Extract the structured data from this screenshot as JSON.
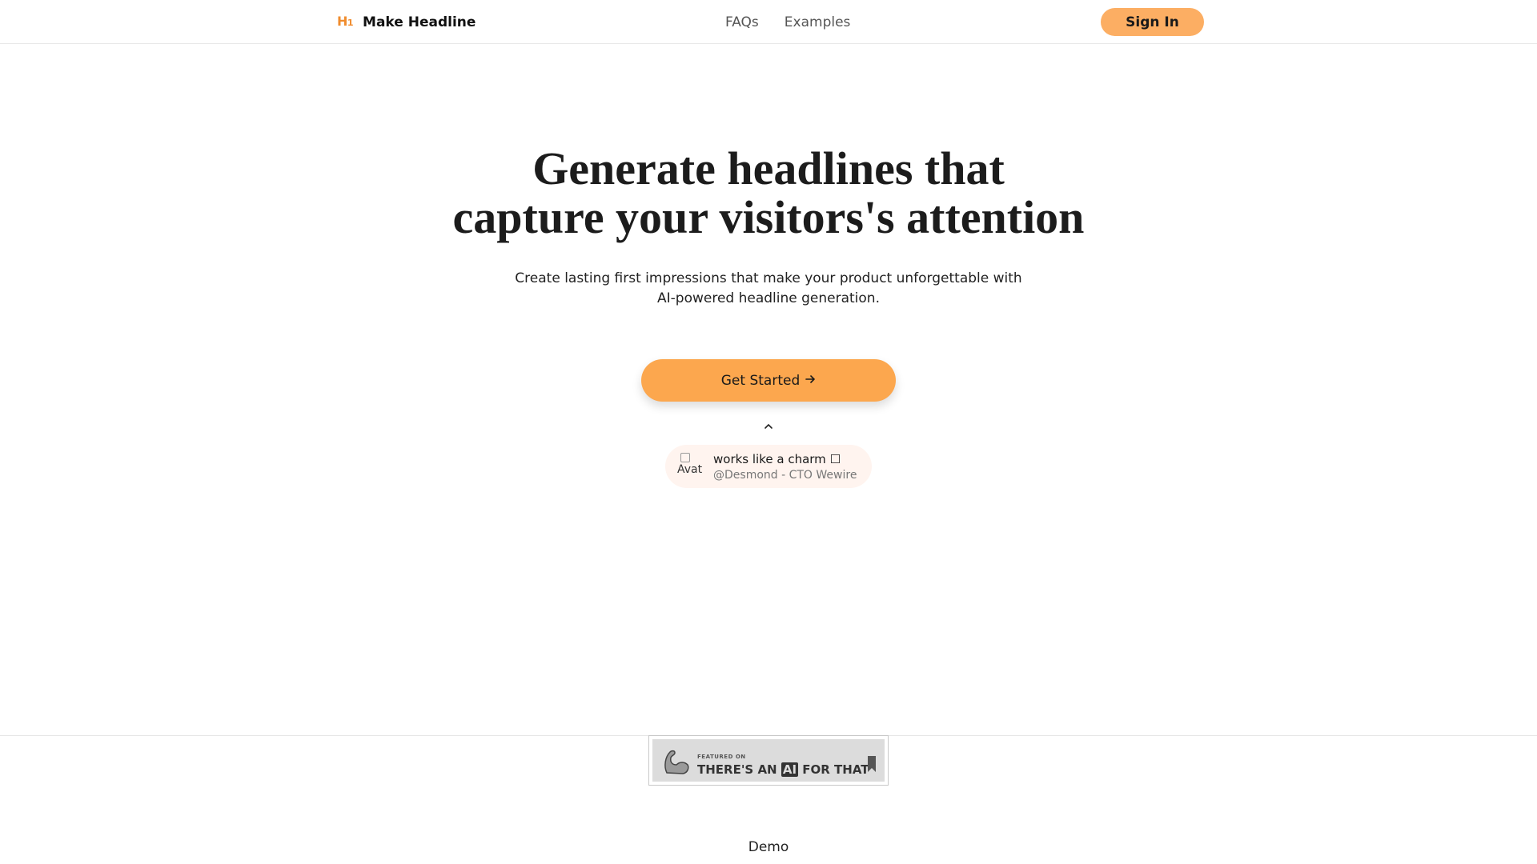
{
  "header": {
    "brand_icon": "H1",
    "brand_name": "Make Headline",
    "nav": [
      {
        "label": "FAQs"
      },
      {
        "label": "Examples"
      }
    ],
    "signin_label": "Sign In"
  },
  "hero": {
    "title_line1": "Generate headlines that",
    "title_line2": "capture your visitors's attention",
    "subtitle": "Create lasting first impressions that make your product unforgettable with AI-powered headline generation.",
    "cta_label": "Get Started",
    "cta_icon": "arrow-right-icon"
  },
  "testimonial": {
    "avatar_alt": "Avat",
    "quote": "works like a charm",
    "author": "@Desmond - CTO Wewire"
  },
  "badge": {
    "small_text": "FEATURED ON",
    "big_text_pre": "THERE'S AN ",
    "big_text_ai": "AI",
    "big_text_post": " FOR THAT"
  },
  "footer": {
    "demo_label": "Demo"
  },
  "colors": {
    "accent": "#fca74e",
    "signin": "#fcae63",
    "brand_icon": "#f08c2e",
    "testimonial_bg": "#fff4ef"
  }
}
